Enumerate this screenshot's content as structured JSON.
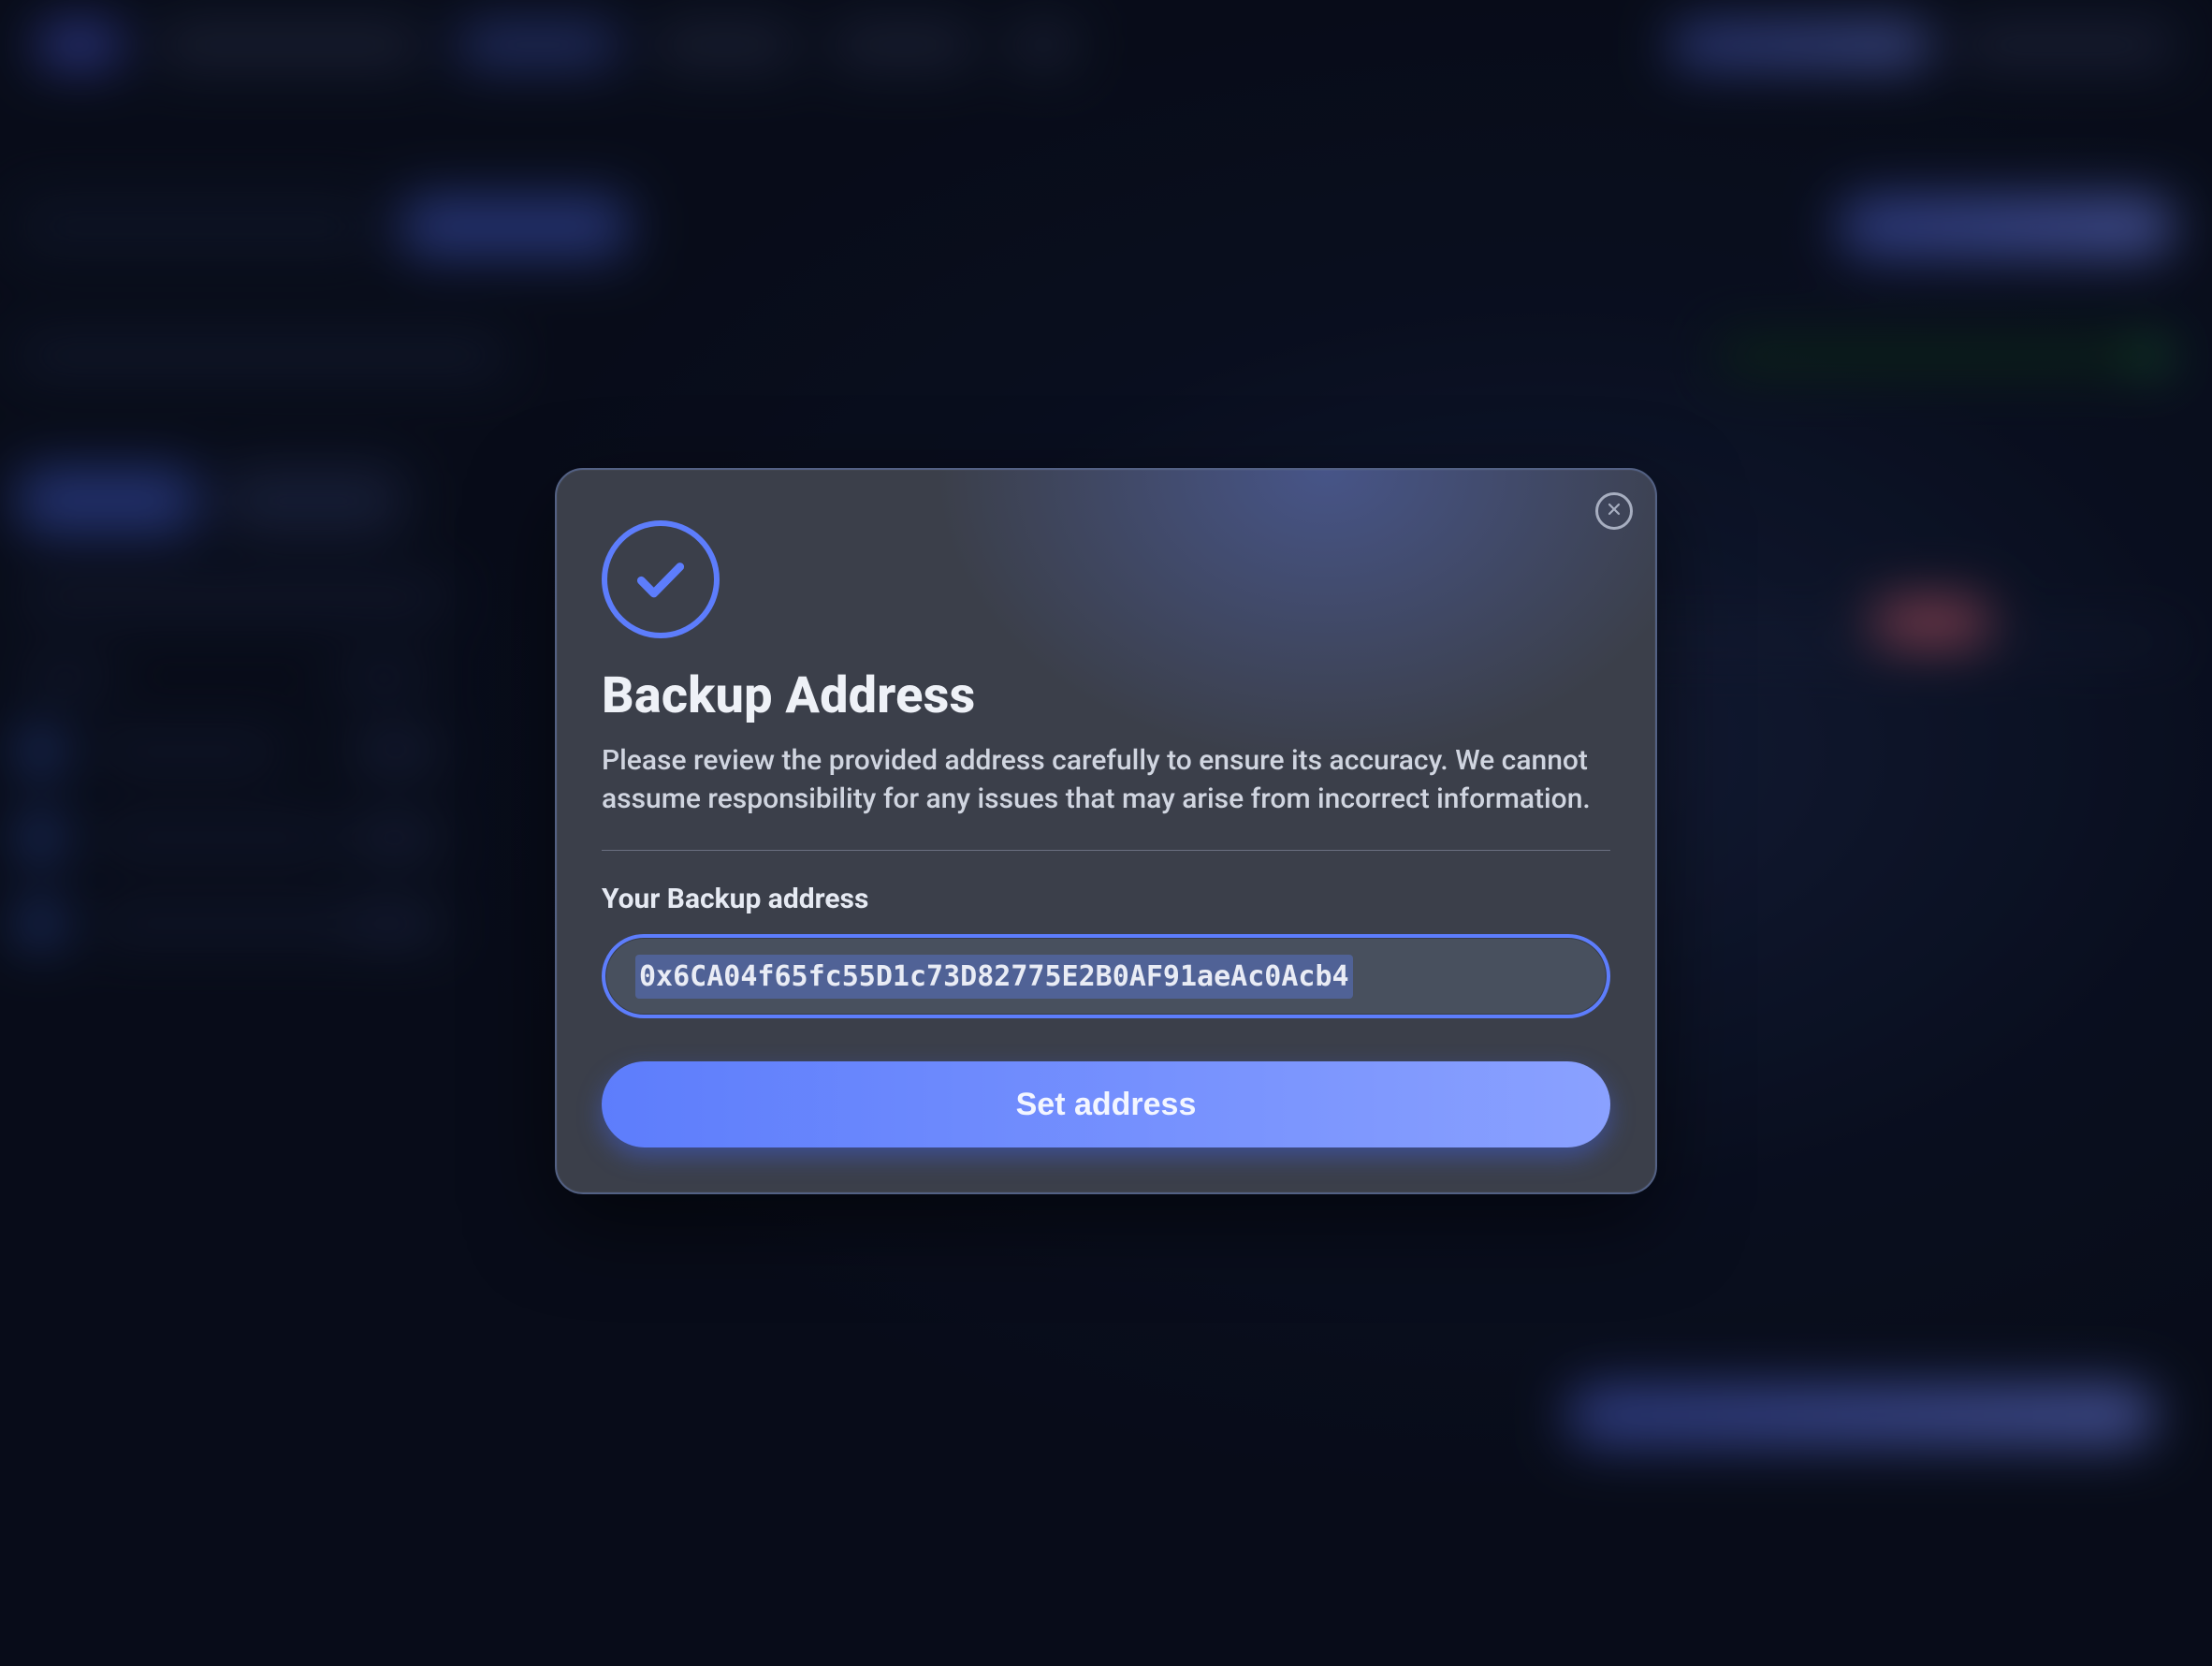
{
  "modal": {
    "icon": "check-circle-icon",
    "title": "Backup Address",
    "description": "Please review the provided address carefully to ensure its accuracy. We cannot assume responsibility for any issues that may arise from incorrect information.",
    "field_label": "Your Backup address",
    "address_value": "0x6CA04f65fc55D1c73D82775E2B0AF91aeAc0Acb4",
    "submit_label": "Set address",
    "close_aria": "Close dialog"
  },
  "colors": {
    "accent": "#5d7dfc",
    "panel": "#3b3f4a",
    "panel_border": "#536184",
    "button_gradient_from": "#5d7dfc",
    "button_gradient_to": "#8aa1ff"
  }
}
